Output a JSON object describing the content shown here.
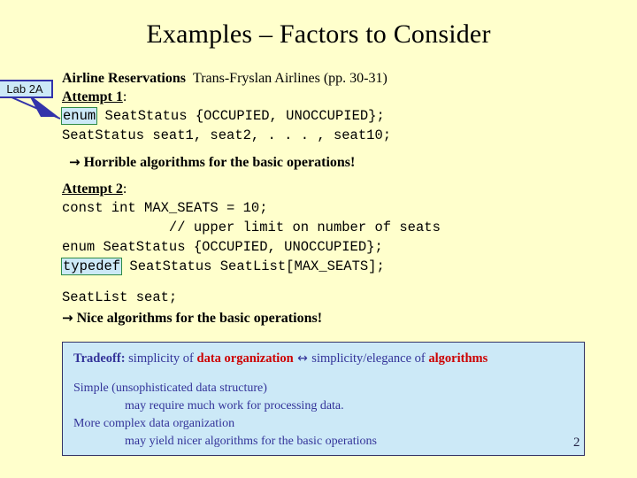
{
  "slide": {
    "title": "Examples – Factors to Consider",
    "page_number": "2",
    "background_color": "#FFFFCC"
  },
  "callout": {
    "label": "Lab 2A",
    "fill_color": "#CCE9F7",
    "border_color": "#3333AA"
  },
  "content": {
    "heading_bold": "Airline Reservations",
    "heading_rest": "Trans-Fryslan Airlines (pp. 30-31)",
    "attempt1_label": "Attempt 1",
    "attempt1_colon": ":",
    "attempt1_code_kw": "enum",
    "attempt1_code_rest": " SeatStatus {OCCUPIED, UNOCCUPIED};",
    "attempt1_code_line2": "SeatStatus seat1, seat2, . . . , seat10;",
    "result1_arrow": "→",
    "result1_text": "Horrible algorithms for the basic operations!",
    "attempt2_label": "Attempt 2",
    "attempt2_colon": ":",
    "attempt2_code_line1": "const int MAX_SEATS = 10;",
    "attempt2_code_line2": "             // upper limit on number of seats",
    "attempt2_code_line3": "enum SeatStatus {OCCUPIED, UNOCCUPIED};",
    "attempt2_code_kw": "typedef",
    "attempt2_code_rest": " SeatStatus SeatList[MAX_SEATS];",
    "attempt2_code_line5": "SeatList seat;",
    "result2_arrow": "→",
    "result2_text": "Nice algorithms for the basic operations!",
    "keyword_highlight_fill": "#CCE9F7",
    "keyword_highlight_border": "#2E8B47"
  },
  "tradeoff": {
    "lead_bold": "Tradeoff:",
    "seg1": " simplicity of ",
    "red1": "data organization",
    "arrow": " ↔ ",
    "seg2": "simplicity/elegance of ",
    "red2": "algorithms",
    "body_line1": "Simple (unsophisticated data structure)",
    "body_line2": "may require much work for processing data.",
    "body_line3": "More complex data organization",
    "body_line4": "may yield nicer algorithms for the basic operations",
    "fill_color": "#CCE9F7",
    "border_color": "#333366",
    "text_color": "#333399",
    "accent_color": "#CC0000"
  }
}
